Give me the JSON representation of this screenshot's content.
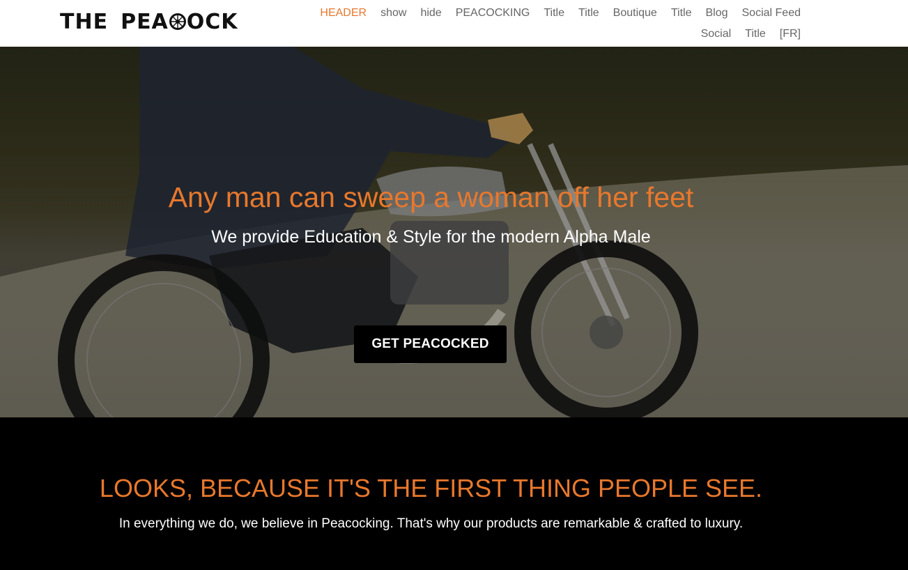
{
  "header": {
    "logo": {
      "part1": "THE",
      "part2": "PEA",
      "part3": "OCK",
      "icon": "wheel-icon"
    },
    "nav": [
      {
        "label": "HEADER",
        "active": true
      },
      {
        "label": "show"
      },
      {
        "label": "hide"
      },
      {
        "label": "PEACOCKING"
      },
      {
        "label": "Title"
      },
      {
        "label": "Title"
      },
      {
        "label": "Boutique"
      },
      {
        "label": "Title"
      },
      {
        "label": "Blog"
      },
      {
        "label": "Social Feed"
      },
      {
        "label": "Social"
      },
      {
        "label": "Title"
      },
      {
        "label": "[FR]"
      }
    ]
  },
  "hero": {
    "title": "Any man can sweep a woman off her feet",
    "subtitle": "We provide Education & Style for the modern Alpha Male",
    "cta_label": "GET PEACOCKED"
  },
  "section": {
    "title": "LOOKS, BECAUSE IT'S THE FIRST THING PEOPLE SEE.",
    "text": "In everything we do, we believe in Peacocking. That's why our products are remarkable & crafted to luxury."
  },
  "colors": {
    "accent": "#e8782d",
    "header_bg": "#ffffff",
    "nav_text": "#666666",
    "section_bg": "#000000"
  }
}
